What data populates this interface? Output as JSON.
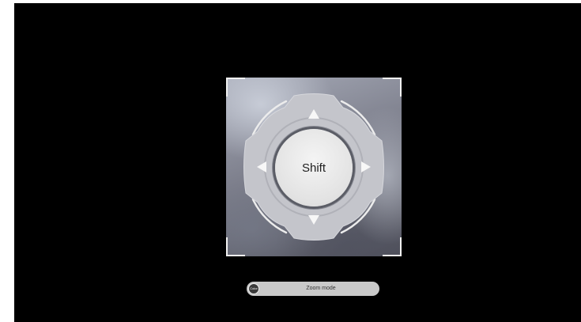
{
  "dpad": {
    "center_label": "Shift",
    "directions": [
      "up",
      "down",
      "left",
      "right"
    ]
  },
  "mode_toggle": {
    "icon_text": "Color",
    "label": "Zoom mode"
  },
  "colors": {
    "background": "#000000",
    "frame": "#f2f2f2",
    "button_face": "#e6e6e6",
    "ring": "#c2c3c8",
    "pill": "#c9c9c9"
  }
}
